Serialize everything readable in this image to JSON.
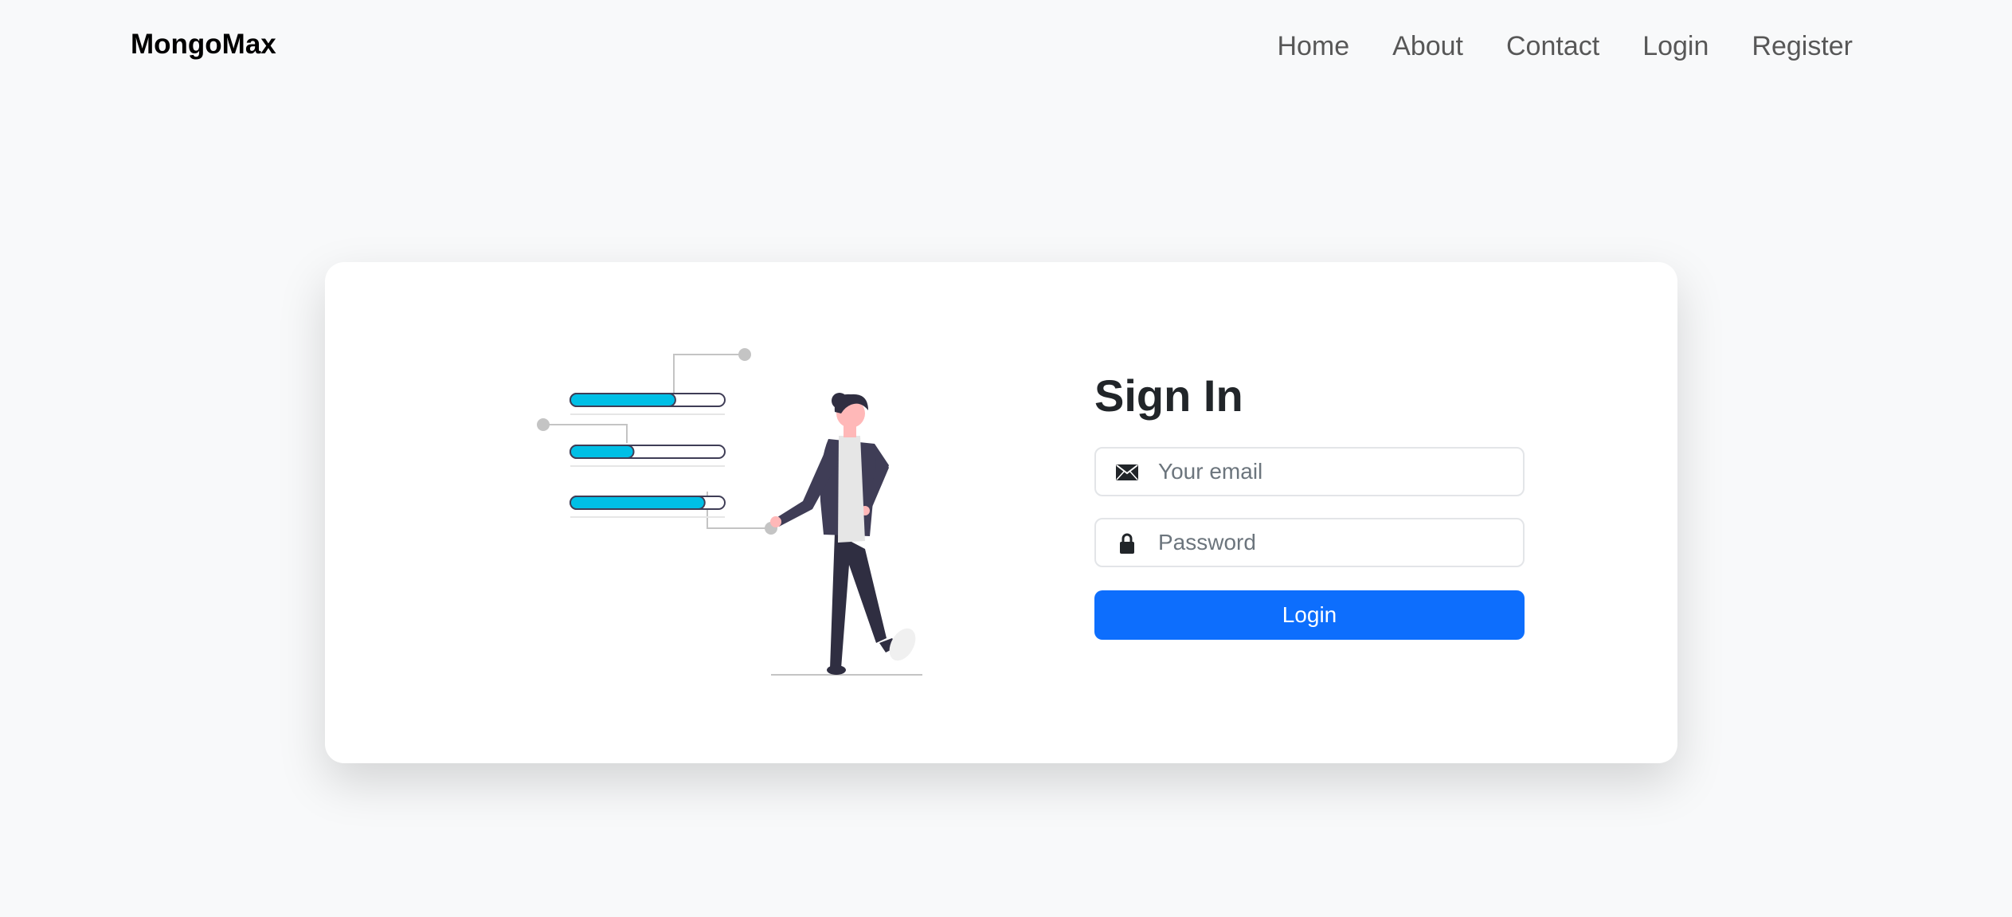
{
  "navbar": {
    "brand": "MongoMax",
    "links": [
      {
        "label": "Home"
      },
      {
        "label": "About"
      },
      {
        "label": "Contact"
      },
      {
        "label": "Login"
      },
      {
        "label": "Register"
      }
    ]
  },
  "signin": {
    "title": "Sign In",
    "email": {
      "placeholder": "Your email",
      "value": "",
      "icon": "envelope-icon"
    },
    "password": {
      "placeholder": "Password",
      "value": "",
      "icon": "lock-icon"
    },
    "submit_label": "Login"
  },
  "illustration": {
    "progress": [
      0.68,
      0.41,
      0.87
    ],
    "accent_color": "#00bfe6",
    "figure_colors": {
      "jacket": "#3f3d56",
      "scarf": "#e6e6e6",
      "skin": "#ffb8b8",
      "hair": "#2f2e41"
    }
  },
  "colors": {
    "primary": "#0d6efd",
    "background": "#f8f9fa",
    "card": "#ffffff"
  }
}
